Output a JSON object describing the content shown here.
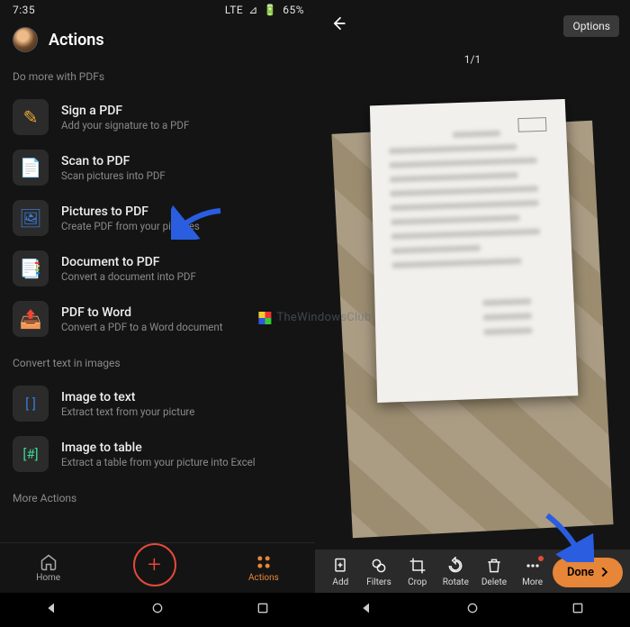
{
  "left": {
    "statusbar": {
      "time": "7:35",
      "net": "LTE",
      "signal": "⊿",
      "batt_icon": "🔋",
      "batt_pct": "65%"
    },
    "title": "Actions",
    "section1_label": "Do more with PDFs",
    "actions_pdf": [
      {
        "icon_color": "#e7a838",
        "icon": "✎",
        "title": "Sign a PDF",
        "sub": "Add your signature to a PDF",
        "name": "sign-pdf"
      },
      {
        "icon_color": "#e5533d",
        "icon": "📄",
        "title": "Scan to PDF",
        "sub": "Scan pictures into PDF",
        "name": "scan-to-pdf"
      },
      {
        "icon_color": "#3a7bd5",
        "icon": "🖼",
        "title": "Pictures to PDF",
        "sub": "Create PDF from your pictures",
        "name": "pictures-to-pdf"
      },
      {
        "icon_color": "#3dd598",
        "icon": "📑",
        "title": "Document to PDF",
        "sub": "Convert a document into PDF",
        "name": "document-to-pdf"
      },
      {
        "icon_color": "#e7a838",
        "icon": "📤",
        "title": "PDF to Word",
        "sub": "Convert a PDF to a Word document",
        "name": "pdf-to-word"
      }
    ],
    "section2_label": "Convert text in images",
    "actions_img": [
      {
        "icon_color": "#3a7bd5",
        "icon": "[ ]",
        "title": "Image to text",
        "sub": "Extract text from your picture",
        "name": "image-to-text"
      },
      {
        "icon_color": "#3dd598",
        "icon": "[#]",
        "title": "Image to table",
        "sub": "Extract a table from your picture into Excel",
        "name": "image-to-table"
      }
    ],
    "section3_label": "More Actions",
    "tabs": {
      "home": "Home",
      "actions": "Actions"
    }
  },
  "right": {
    "options_label": "Options",
    "page_counter": "1/1",
    "tools": {
      "add": "Add",
      "filters": "Filters",
      "crop": "Crop",
      "rotate": "Rotate",
      "delete": "Delete",
      "more": "More"
    },
    "done_label": "Done"
  },
  "watermark": "TheWindowsClub"
}
